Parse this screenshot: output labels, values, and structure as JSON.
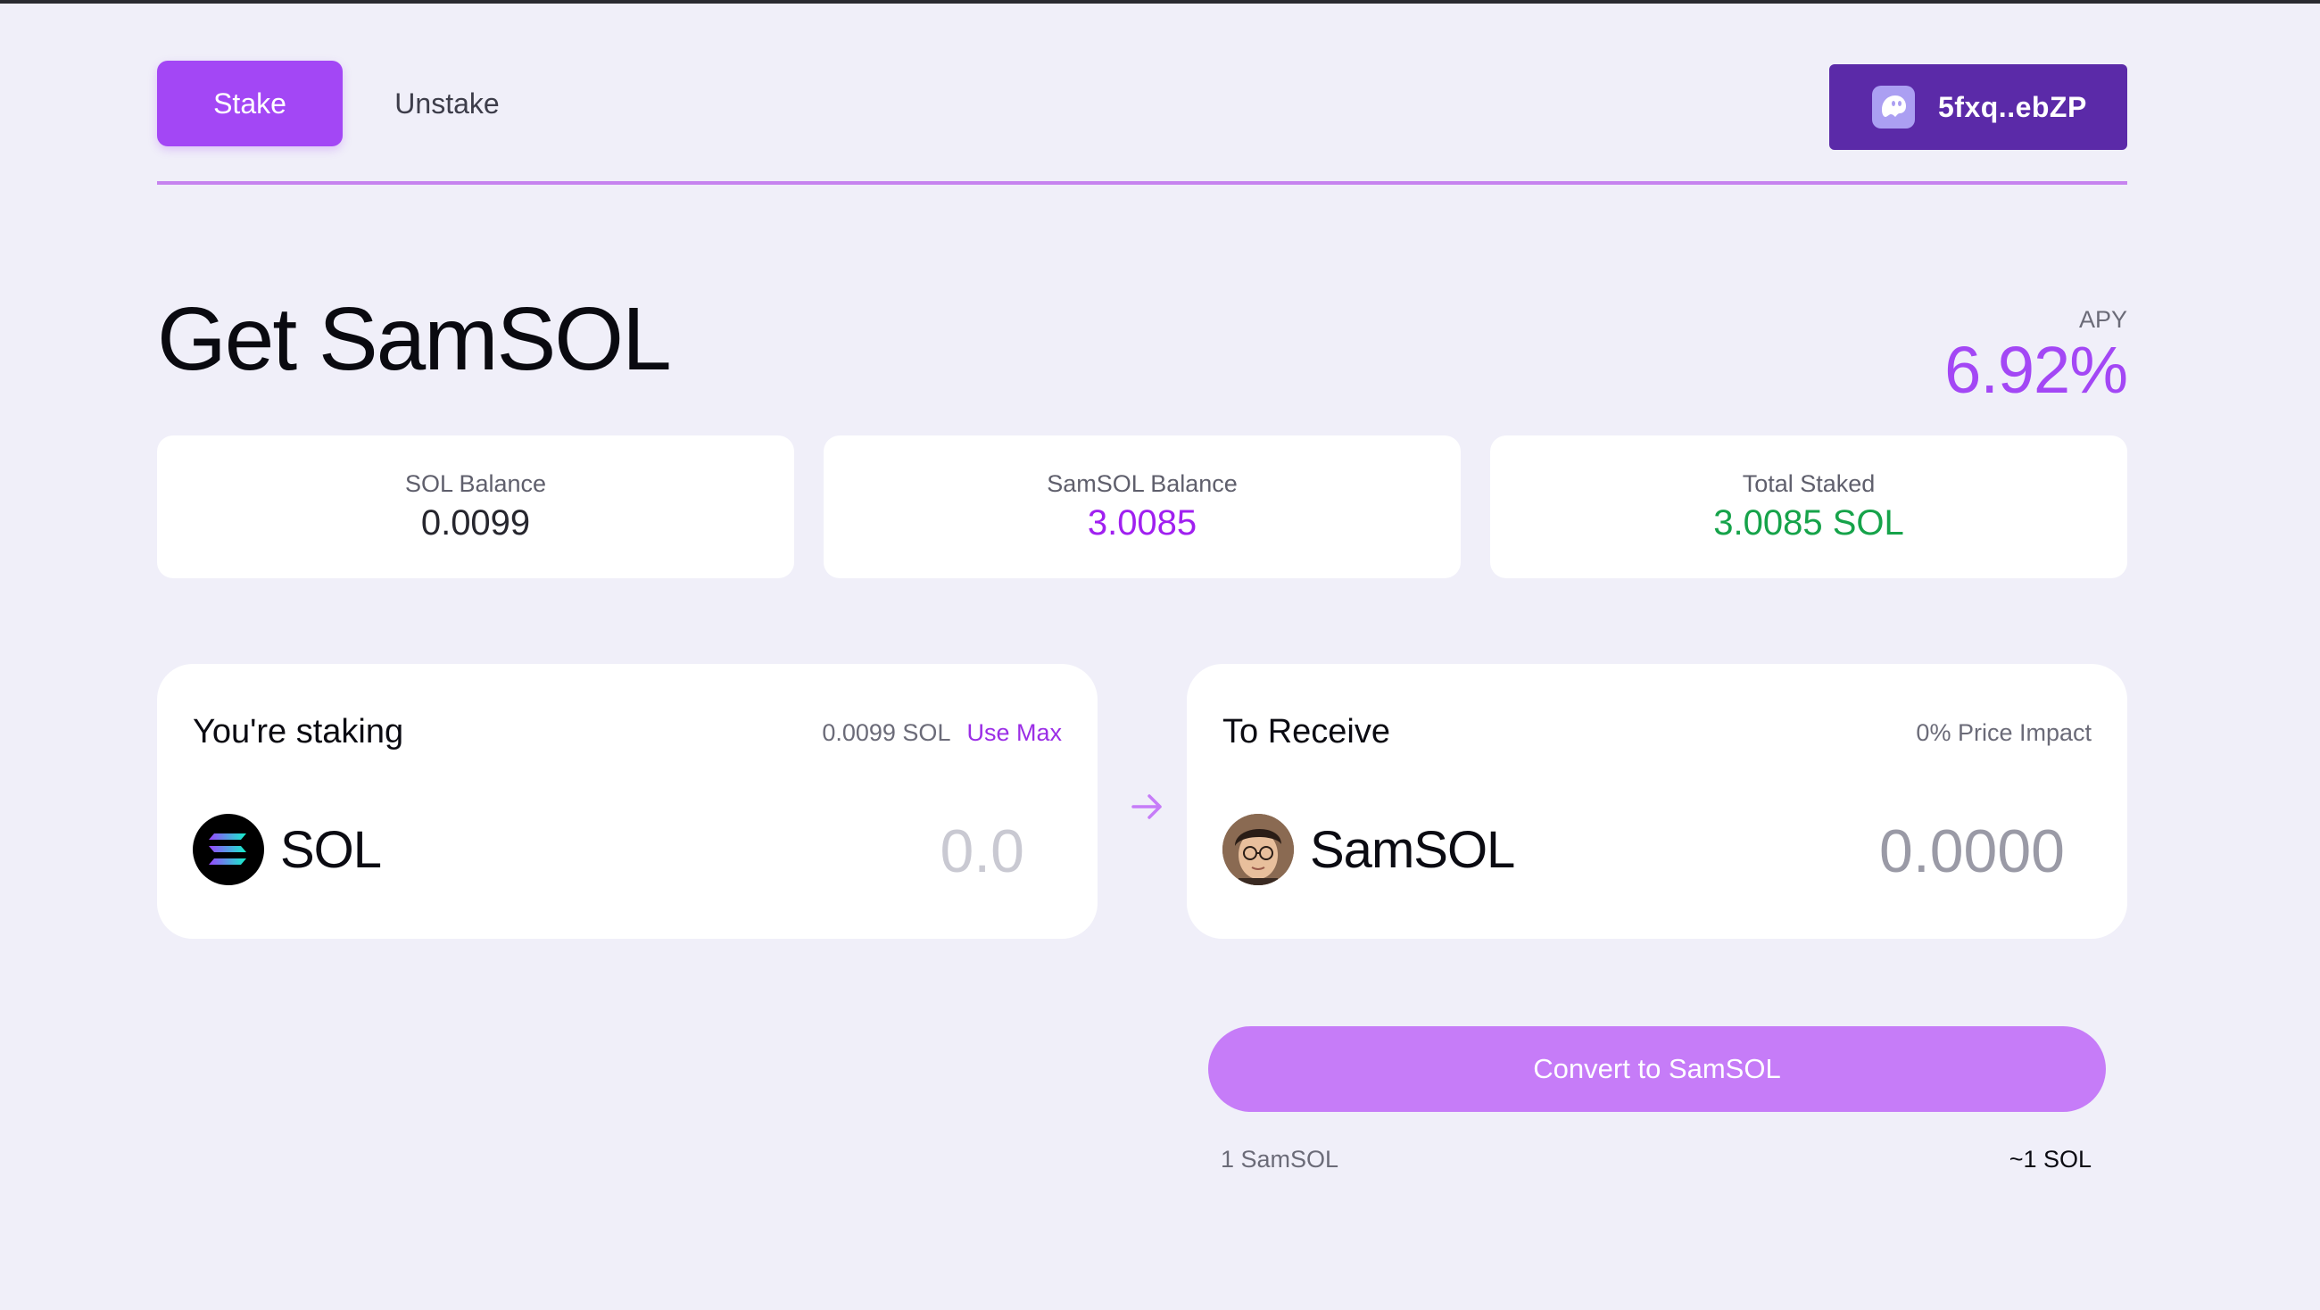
{
  "nav": {
    "tabs": [
      {
        "label": "Stake",
        "active": true
      },
      {
        "label": "Unstake",
        "active": false
      }
    ],
    "wallet": {
      "address": "5fxq..ebZP",
      "icon": "phantom-ghost-icon"
    }
  },
  "hero": {
    "title": "Get SamSOL",
    "apy_label": "APY",
    "apy_value": "6.92%"
  },
  "stats": [
    {
      "label": "SOL Balance",
      "value": "0.0099",
      "color": "#26262e"
    },
    {
      "label": "SamSOL Balance",
      "value": "3.0085",
      "color": "#a020f0"
    },
    {
      "label": "Total Staked",
      "value": "3.0085 SOL",
      "color": "#16a34a"
    }
  ],
  "stake_card": {
    "heading": "You're staking",
    "balance": "0.0099 SOL",
    "use_max": "Use Max",
    "token": "SOL",
    "token_icon": "solana-logo-icon",
    "amount_placeholder": "0.0"
  },
  "receive_card": {
    "heading": "To Receive",
    "price_impact": "0% Price Impact",
    "token": "SamSOL",
    "token_icon": "samsol-avatar-icon",
    "amount": "0.0000"
  },
  "convert": {
    "button_label": "Convert to SamSOL",
    "rate_left": "1 SamSOL",
    "rate_right": "~1 SOL"
  },
  "colors": {
    "accent": "#a347f5",
    "wallet_bg": "#5b2aa8",
    "convert_bg": "#c67cf8",
    "page_bg": "#f0eff9"
  }
}
